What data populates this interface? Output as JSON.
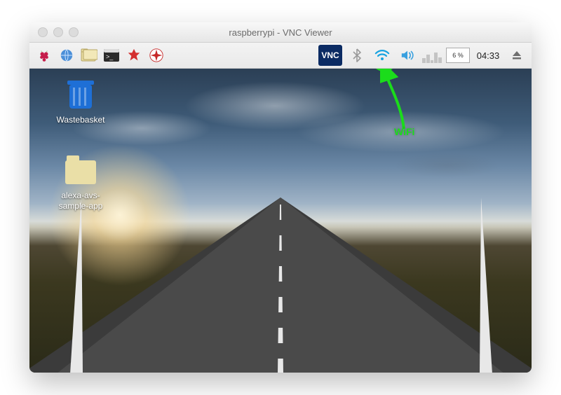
{
  "window": {
    "title": "raspberrypi - VNC Viewer"
  },
  "taskbar": {
    "launchers": [
      {
        "name": "menu-raspberry-icon"
      },
      {
        "name": "web-browser-icon"
      },
      {
        "name": "file-manager-icon"
      },
      {
        "name": "terminal-icon"
      },
      {
        "name": "mathematica-icon"
      },
      {
        "name": "wolfram-icon"
      }
    ],
    "tray": {
      "vnc": "VNC",
      "cpu_percent": "6 %",
      "clock": "04:33"
    }
  },
  "desktop": {
    "icons": [
      {
        "id": "wastebasket",
        "label": "Wastebasket"
      },
      {
        "id": "folder1",
        "label": "alexa-avs-sample-app"
      }
    ]
  },
  "annotation": {
    "label": "WiFi"
  }
}
